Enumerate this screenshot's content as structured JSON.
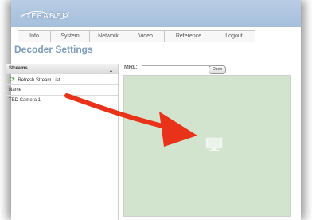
{
  "app": {
    "logo_text": "TERADEK",
    "page_title": "Decoder Settings"
  },
  "nav": {
    "tabs": [
      {
        "label": "Info"
      },
      {
        "label": "System"
      },
      {
        "label": "Network"
      },
      {
        "label": "Video"
      },
      {
        "label": "Reference"
      },
      {
        "label": "Logout"
      }
    ]
  },
  "streams": {
    "header": "Streams",
    "refresh_label": "Refresh Stream List",
    "column_name": "Name",
    "items": [
      {
        "name": "TED Camera 1"
      }
    ]
  },
  "player": {
    "mrl_label": "MRL:",
    "mrl_value": "",
    "open_label": "Open",
    "background": "#d2e4cd",
    "icon": "monitor-icon"
  },
  "annotation": {
    "icon": "arrow-icon",
    "color": "#e8331a"
  },
  "colors": {
    "header": "#a5bfdc",
    "title": "#7d9dbb"
  }
}
